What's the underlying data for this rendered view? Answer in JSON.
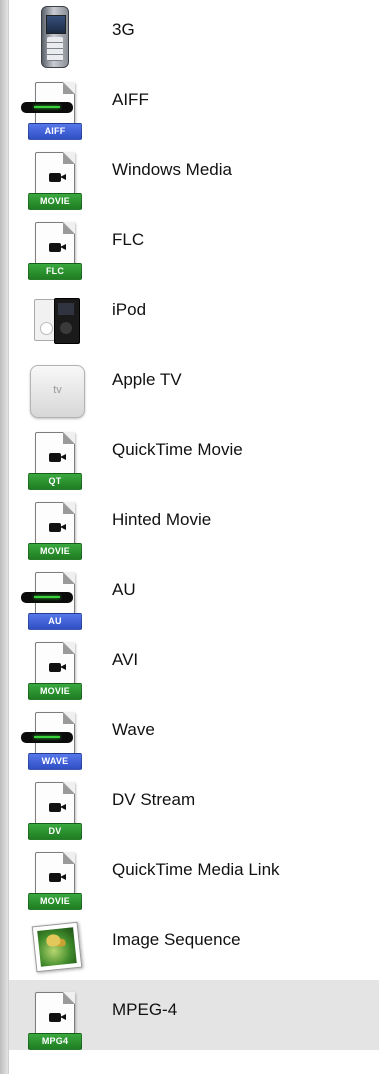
{
  "items": [
    {
      "label": "3G",
      "icon": "phone-icon",
      "badge": ""
    },
    {
      "label": "AIFF",
      "icon": "audio-file-icon",
      "badge": "AIFF"
    },
    {
      "label": "Windows Media",
      "icon": "movie-file-icon",
      "badge": "MOVIE"
    },
    {
      "label": "FLC",
      "icon": "movie-file-icon",
      "badge": "FLC"
    },
    {
      "label": "iPod",
      "icon": "ipod-icon",
      "badge": ""
    },
    {
      "label": "Apple TV",
      "icon": "apple-tv-icon",
      "badge": "tv"
    },
    {
      "label": "QuickTime Movie",
      "icon": "movie-file-icon",
      "badge": "QT"
    },
    {
      "label": "Hinted Movie",
      "icon": "movie-file-icon",
      "badge": "MOVIE"
    },
    {
      "label": "AU",
      "icon": "audio-file-icon",
      "badge": "AU"
    },
    {
      "label": "AVI",
      "icon": "movie-file-icon",
      "badge": "MOVIE"
    },
    {
      "label": "Wave",
      "icon": "audio-file-icon",
      "badge": "WAVE"
    },
    {
      "label": "DV Stream",
      "icon": "movie-file-icon",
      "badge": "DV"
    },
    {
      "label": "QuickTime Media Link",
      "icon": "movie-file-icon",
      "badge": "MOVIE"
    },
    {
      "label": "Image Sequence",
      "icon": "image-sequence-icon",
      "badge": ""
    },
    {
      "label": "MPEG-4",
      "icon": "movie-file-icon",
      "badge": "MPG4",
      "selected": true
    }
  ],
  "colors": {
    "movie_badge": "#2a8f2f",
    "audio_badge": "#3b5bd8",
    "selection": "#e4e4e4"
  }
}
